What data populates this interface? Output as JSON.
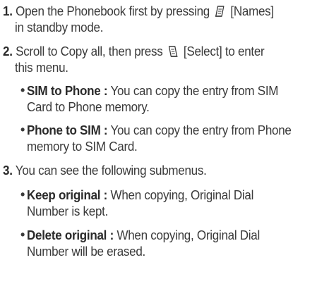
{
  "steps": [
    {
      "number": "1.",
      "line1_before": "Open the Phonebook first by pressing",
      "line1_after": "[Names]",
      "line2": "in standby mode.",
      "icon": "left-soft-key-icon"
    },
    {
      "number": "2.",
      "line1_before": "Scroll to Copy all, then press",
      "line1_after": "[Select] to enter",
      "line2": "this menu.",
      "icon": "right-soft-key-icon",
      "bullets": [
        {
          "lead": "SIM to Phone :",
          "line1_rest": "You can copy the entry from SIM",
          "line2": "Card to Phone memory."
        },
        {
          "lead": "Phone to SIM :",
          "line1_rest": "You can copy the entry from Phone",
          "line2": "memory to SIM Card."
        }
      ]
    },
    {
      "number": "3.",
      "line1_before": "You can see the following submenus.",
      "bullets": [
        {
          "lead": "Keep original :",
          "line1_rest": "When copying, Original Dial",
          "line2": "Number is kept."
        },
        {
          "lead": "Delete original :",
          "line1_rest": "When copying, Original Dial",
          "line2": "Number will be erased."
        }
      ]
    }
  ]
}
